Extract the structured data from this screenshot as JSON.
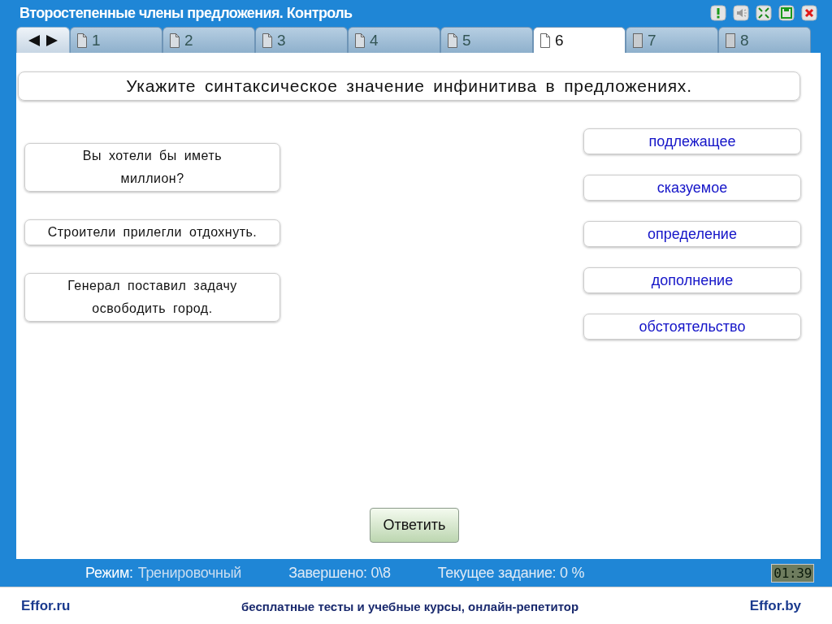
{
  "window": {
    "title": "Второстепенные члены предложения. Контроль"
  },
  "toolbar": [
    {
      "kind": "hint"
    },
    {
      "kind": "sound"
    },
    {
      "kind": "fullscreen"
    },
    {
      "kind": "save"
    },
    {
      "kind": "close"
    }
  ],
  "tabs": [
    {
      "label": "1",
      "selected": false,
      "kind": "visited"
    },
    {
      "label": "2",
      "selected": false,
      "kind": "visited"
    },
    {
      "label": "3",
      "selected": false,
      "kind": "visited"
    },
    {
      "label": "4",
      "selected": false,
      "kind": "visited"
    },
    {
      "label": "5",
      "selected": false,
      "kind": "visited"
    },
    {
      "label": "6",
      "selected": true,
      "kind": "visited"
    },
    {
      "label": "7",
      "selected": false,
      "kind": "new"
    },
    {
      "label": "8",
      "selected": false,
      "kind": "new"
    }
  ],
  "question": "Укажите синтаксическое значение инфинитива в предложениях.",
  "sentences": [
    "Вы хотели бы иметь миллион?",
    "Строители прилегли отдохнуть.",
    "Генерал поставил задачу освободить город."
  ],
  "options": [
    "подлежащее",
    "сказуемое",
    "определение",
    "дополнение",
    "обстоятельство"
  ],
  "submit_button": "Ответить",
  "status_bar": {
    "mode_label": "Режим:",
    "mode_value": "Тренировочный",
    "completed": "Завершено: 0\\8",
    "current_task": "Текущее задание: 0 %",
    "timer": "01:39"
  },
  "footer": {
    "left": "Effor.ru",
    "center": "бесплатные тесты и учебные курсы, онлайн-репетитор",
    "right": "Effor.by"
  }
}
